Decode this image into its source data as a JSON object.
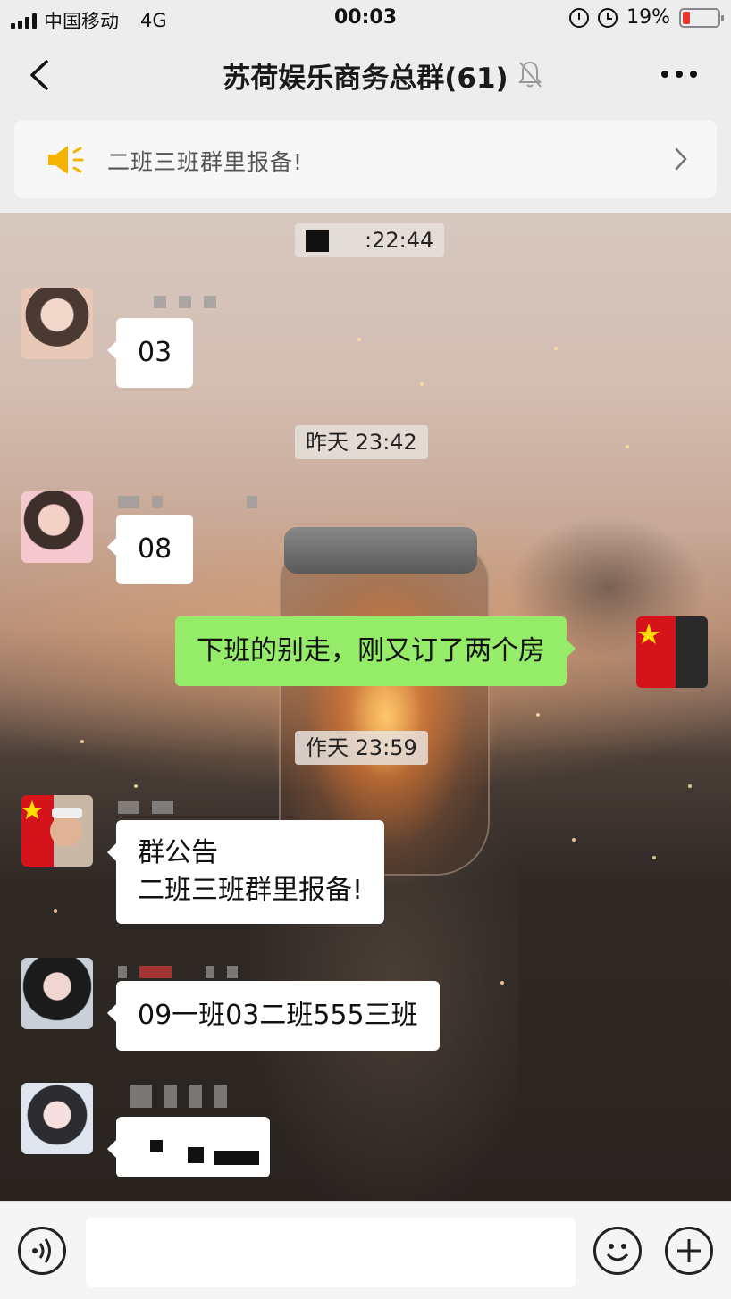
{
  "status_bar": {
    "carrier": "中国移动",
    "network": "4G",
    "time": "00:03",
    "battery_percent": "19%",
    "battery_level": 0.19,
    "icons": [
      "signal-icon",
      "rotation-lock-icon",
      "alarm-icon",
      "battery-icon"
    ]
  },
  "nav": {
    "title": "苏荷娱乐商务总群(61)",
    "icons": [
      "back-icon",
      "mute-bell-icon",
      "more-icon"
    ]
  },
  "announcement": {
    "text": "二班三班群里报备!",
    "icons": [
      "speaker-icon",
      "chevron-right-icon"
    ]
  },
  "messages": [
    {
      "type": "timestamp",
      "text": ":22:44"
    },
    {
      "type": "incoming",
      "text": "03"
    },
    {
      "type": "timestamp",
      "text": "昨天 23:42"
    },
    {
      "type": "incoming",
      "text": "08"
    },
    {
      "type": "outgoing",
      "text": "下班的别走，刚又订了两个房"
    },
    {
      "type": "timestamp",
      "text": "作天 23:59"
    },
    {
      "type": "incoming",
      "line1": "群公告",
      "line2": "二班三班群里报备!"
    },
    {
      "type": "incoming",
      "text": "09一班03二班555三班"
    },
    {
      "type": "incoming",
      "text": ""
    }
  ],
  "input_bar": {
    "icons": [
      "voice-icon",
      "emoji-icon",
      "plus-icon"
    ]
  },
  "colors": {
    "background": "#ededed",
    "outgoing_bubble": "#95ec69",
    "incoming_bubble": "#ffffff",
    "battery_low": "#e8332d",
    "speaker": "#f5b400"
  }
}
